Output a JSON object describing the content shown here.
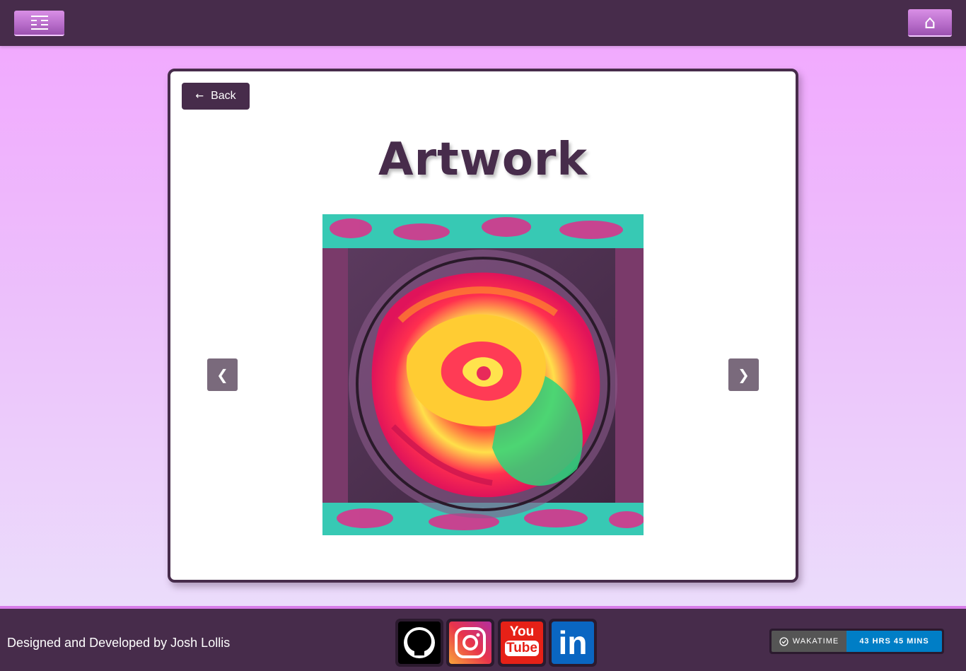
{
  "header": {
    "menu_icon": "menu-icon",
    "home_icon": "home-icon",
    "home_glyph": "⌂"
  },
  "card": {
    "back_arrow": "←",
    "back_label": "Back",
    "title": "Artwork",
    "prev_glyph": "❮",
    "next_glyph": "❯"
  },
  "footer": {
    "credit": "Designed and Developed by Josh Lollis",
    "social": [
      "github-icon",
      "instagram-icon",
      "youtube-icon",
      "linkedin-icon"
    ],
    "youtube_top": "You",
    "youtube_bottom": "Tube",
    "linkedin_text": "in",
    "wakatime_label": "WAKATIME",
    "wakatime_value": "43 HRS 45 MINS"
  },
  "colors": {
    "brand": "#472c4b",
    "accent": "#d77ce8",
    "wakatime_blue": "#007ec6"
  }
}
